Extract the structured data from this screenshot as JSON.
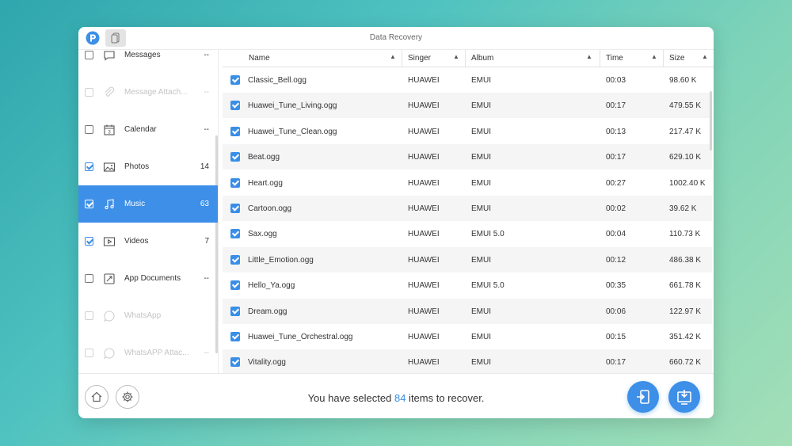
{
  "window": {
    "title": "Data Recovery"
  },
  "sidebar": {
    "items": [
      {
        "label": "Messages",
        "count": "--",
        "checked": false,
        "disabled": false,
        "active": false,
        "icon": "message-icon"
      },
      {
        "label": "Message Attach...",
        "count": "--",
        "checked": false,
        "disabled": true,
        "active": false,
        "icon": "attachment-icon"
      },
      {
        "label": "Calendar",
        "count": "--",
        "checked": false,
        "disabled": false,
        "active": false,
        "icon": "calendar-icon"
      },
      {
        "label": "Photos",
        "count": "14",
        "checked": true,
        "disabled": false,
        "active": false,
        "icon": "photo-icon"
      },
      {
        "label": "Music",
        "count": "63",
        "checked": true,
        "disabled": false,
        "active": true,
        "icon": "music-icon"
      },
      {
        "label": "Videos",
        "count": "7",
        "checked": true,
        "disabled": false,
        "active": false,
        "icon": "video-icon"
      },
      {
        "label": "App Documents",
        "count": "--",
        "checked": false,
        "disabled": false,
        "active": false,
        "icon": "document-icon"
      },
      {
        "label": "WhatsApp",
        "count": "",
        "checked": false,
        "disabled": true,
        "active": false,
        "icon": "whatsapp-icon"
      },
      {
        "label": "WhatsAPP Attac...",
        "count": "--",
        "checked": false,
        "disabled": true,
        "active": false,
        "icon": "whatsapp-attachment-icon"
      }
    ]
  },
  "table": {
    "columns": [
      "Name",
      "Singer",
      "Album",
      "Time",
      "Size"
    ],
    "rows": [
      [
        "Classic_Bell.ogg",
        "HUAWEI",
        "EMUI",
        "00:03",
        "98.60 K"
      ],
      [
        "Huawei_Tune_Living.ogg",
        "HUAWEI",
        "EMUI",
        "00:17",
        "479.55 K"
      ],
      [
        "Huawei_Tune_Clean.ogg",
        "HUAWEI",
        "EMUI",
        "00:13",
        "217.47 K"
      ],
      [
        "Beat.ogg",
        "HUAWEI",
        "EMUI",
        "00:17",
        "629.10 K"
      ],
      [
        "Heart.ogg",
        "HUAWEI",
        "EMUI",
        "00:27",
        "1002.40 K"
      ],
      [
        "Cartoon.ogg",
        "HUAWEI",
        "EMUI",
        "00:02",
        "39.62 K"
      ],
      [
        "Sax.ogg",
        "HUAWEI",
        "EMUI 5.0",
        "00:04",
        "110.73 K"
      ],
      [
        "Little_Emotion.ogg",
        "HUAWEI",
        "EMUI",
        "00:12",
        "486.38 K"
      ],
      [
        "Hello_Ya.ogg",
        "HUAWEI",
        "EMUI 5.0",
        "00:35",
        "661.78 K"
      ],
      [
        "Dream.ogg",
        "HUAWEI",
        "EMUI",
        "00:06",
        "122.97 K"
      ],
      [
        "Huawei_Tune_Orchestral.ogg",
        "HUAWEI",
        "EMUI",
        "00:15",
        "351.42 K"
      ],
      [
        "Vitality.ogg",
        "HUAWEI",
        "EMUI",
        "00:17",
        "660.72 K"
      ]
    ]
  },
  "footer": {
    "status_prefix": "You have selected ",
    "selected_count": "84",
    "status_suffix": " items to recover."
  },
  "colors": {
    "accent": "#3d8fe8",
    "checkbox": "#3a8ee6"
  }
}
